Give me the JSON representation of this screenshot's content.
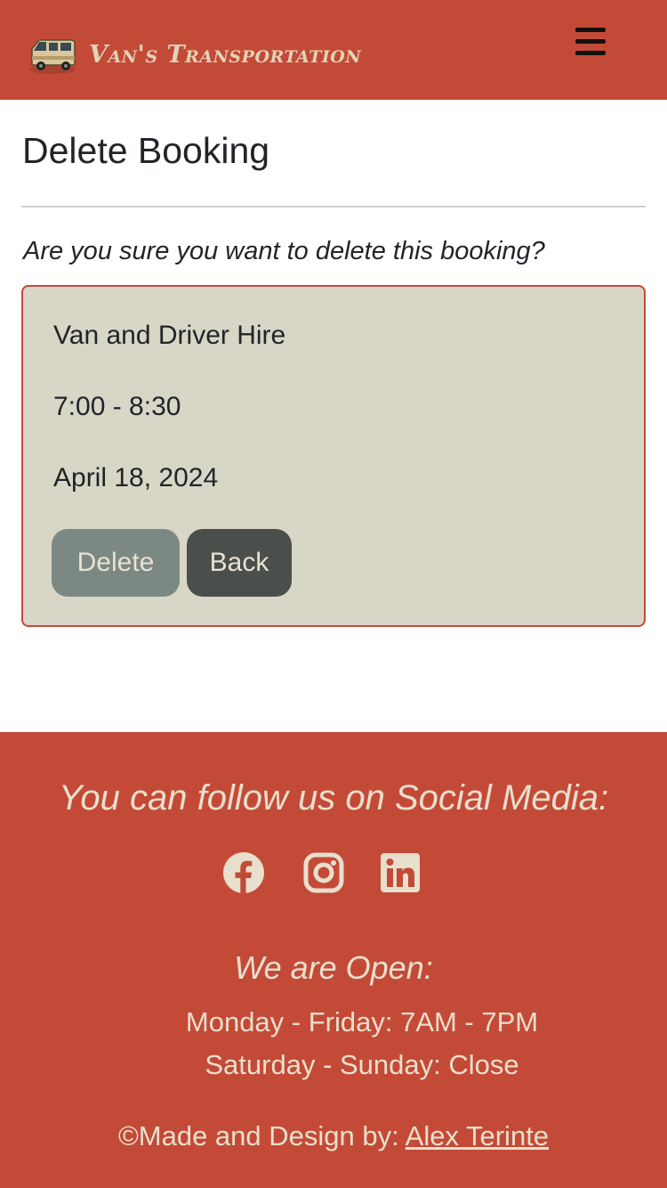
{
  "header": {
    "brand_name": "Van's Transportation",
    "colors": {
      "background": "#c44a38",
      "brand_text": "#e0d3b8",
      "menu_icon": "#111111"
    },
    "logo_icon": "van-logo-icon",
    "menu_icon": "hamburger-menu-icon"
  },
  "main": {
    "title": "Delete Booking",
    "question": "Are you sure you want to delete this booking?",
    "booking": {
      "service": "Van and Driver Hire",
      "time": "7:00 - 8:30",
      "date": "April 18, 2024"
    },
    "buttons": {
      "delete_label": "Delete",
      "back_label": "Back"
    },
    "colors": {
      "card_bg": "#d8d6c6",
      "card_border": "#c44a38",
      "delete_btn": "#7c8883",
      "back_btn": "#4a4f4b"
    }
  },
  "footer": {
    "social_heading": "You can follow us on Social Media:",
    "social_icons": [
      "facebook-icon",
      "instagram-icon",
      "linkedin-icon"
    ],
    "hours_heading": "We are Open:",
    "hours": [
      "Monday - Friday: 7AM - 7PM",
      "Saturday - Sunday: Close"
    ],
    "credit_prefix": "©Made and Design by: ",
    "credit_name": "Alex Terinte",
    "colors": {
      "background": "#c44a38",
      "text": "#e8dfcc"
    }
  }
}
